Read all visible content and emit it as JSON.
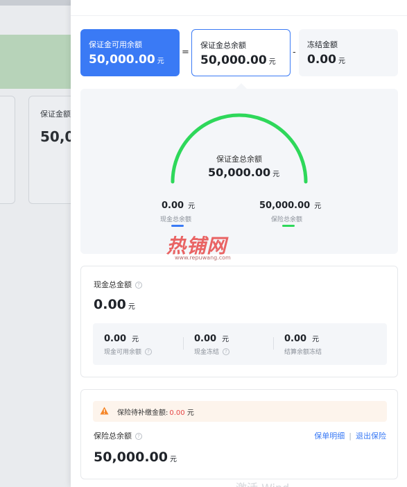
{
  "background_page": {
    "card_label": "保证金额",
    "card_value": "50,0"
  },
  "summary": {
    "available": {
      "label": "保证金可用余额",
      "value": "50,000.00",
      "unit": "元"
    },
    "equals": "=",
    "total": {
      "label": "保证金总余额",
      "value": "50,000.00",
      "unit": "元"
    },
    "minus": "-",
    "frozen": {
      "label": "冻结金额",
      "value": "0.00",
      "unit": "元"
    }
  },
  "gauge": {
    "title": "保证金总余额",
    "value": "50,000.00",
    "unit": "元",
    "cash_fraction": 0,
    "insurance_fraction": 1,
    "legend": [
      {
        "value": "0.00",
        "unit": "元",
        "label": "现金总余额",
        "color": "#3a7af5"
      },
      {
        "value": "50,000.00",
        "unit": "元",
        "label": "保险总余额",
        "color": "#2ed85a"
      }
    ]
  },
  "watermark": {
    "text": "热铺网",
    "url": "www.repuwang.com"
  },
  "cash_card": {
    "title": "现金总金额",
    "value": "0.00",
    "unit": "元",
    "items": [
      {
        "value": "0.00",
        "unit": "元",
        "label": "现金可用余额"
      },
      {
        "value": "0.00",
        "unit": "元",
        "label": "现金冻结"
      },
      {
        "value": "0.00",
        "unit": "元",
        "label": "结算余额冻结"
      }
    ]
  },
  "insurance_card": {
    "alert_label": "保险待补缴金额:",
    "alert_amount": "0.00",
    "alert_unit": "元",
    "title": "保险总余额",
    "value": "50,000.00",
    "unit": "元",
    "link_details": "保单明细",
    "link_separator": "|",
    "link_exit": "退出保险"
  },
  "footer_text": "激活 Wind",
  "colors": {
    "primary": "#3a7af5",
    "gauge_green": "#2ed85a",
    "alert_red": "#e54545",
    "warning_orange": "#f5872a"
  }
}
